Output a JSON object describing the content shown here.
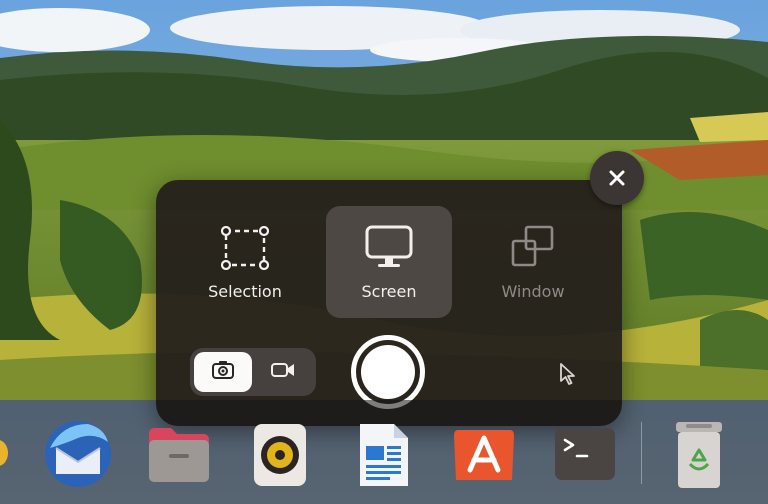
{
  "screenshot_panel": {
    "modes": [
      {
        "label": "Selection",
        "icon": "selection-icon",
        "active": false
      },
      {
        "label": "Screen",
        "icon": "monitor-icon",
        "active": true
      },
      {
        "label": "Window",
        "icon": "window-icon",
        "active": false
      }
    ],
    "capture_type": {
      "options": [
        {
          "name": "screenshot",
          "icon": "camera-icon",
          "selected": true
        },
        {
          "name": "screencast",
          "icon": "video-camera-icon",
          "selected": false
        }
      ]
    },
    "show_pointer": false
  },
  "dock": {
    "apps": [
      {
        "name": "partial-app",
        "icon": "app-icon"
      },
      {
        "name": "thunderbird",
        "icon": "thunderbird-mail-icon"
      },
      {
        "name": "files",
        "icon": "folder-icon"
      },
      {
        "name": "rhythmbox",
        "icon": "speaker-icon"
      },
      {
        "name": "libreoffice-writer",
        "icon": "document-icon"
      },
      {
        "name": "app-center",
        "icon": "app-store-icon"
      },
      {
        "name": "terminal",
        "icon": "terminal-icon"
      },
      {
        "name": "trash",
        "icon": "trash-icon"
      }
    ]
  },
  "colors": {
    "panel_bg": "#241f1c",
    "active_mode": "#4d4844",
    "app_center": "#e9552c",
    "thunderbird": "#2b63b8"
  }
}
